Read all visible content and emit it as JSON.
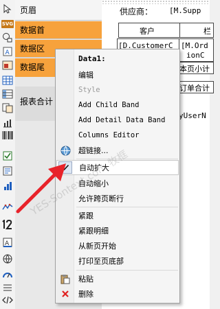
{
  "toolbar": {
    "items": [
      {
        "icon": "arrow-tool-icon"
      },
      {
        "icon": "svg-object-icon",
        "label": "SVG"
      },
      {
        "icon": "shape-icon"
      },
      {
        "icon": "text-object-icon"
      },
      {
        "icon": "picture-icon"
      },
      {
        "icon": "table-icon"
      },
      {
        "icon": "matrix-icon"
      },
      {
        "icon": "subreport-icon"
      },
      {
        "icon": "barcode-icon"
      },
      {
        "icon": "checkbox-icon"
      },
      {
        "icon": "rich-text-icon"
      },
      {
        "icon": "chart-icon"
      },
      {
        "icon": "sparkline-icon"
      },
      {
        "icon": "zip-code-icon"
      },
      {
        "icon": "cellular-text-icon"
      },
      {
        "icon": "map-icon"
      },
      {
        "icon": "gauge-icon"
      },
      {
        "icon": "html-icon"
      }
    ]
  },
  "bands": {
    "page_header": "页眉",
    "data_header": "数据首",
    "data_area": "数据区",
    "data_footer": "数据尾",
    "report_summary": "报表合计"
  },
  "surface": {
    "supplier_label": "供应商：",
    "supplier_value": "[M.Supp",
    "customer_header": "客户",
    "col2_header": "栏",
    "customer_field": "[D.CustomerC",
    "order_field": "[M.Ord",
    "order_field_2": "ionC",
    "page_subtotal": "本页小计",
    "order_total": "订单合计",
    "user_field": "yUserN"
  },
  "menu": {
    "title": "Data1:",
    "items": [
      {
        "label": "编辑",
        "enabled": true
      },
      {
        "label": "Style",
        "enabled": false
      },
      {
        "label": "Add Child Band",
        "enabled": true
      },
      {
        "label": "Add Detail Data Band",
        "enabled": true
      },
      {
        "label": "Columns Editor",
        "enabled": true
      },
      {
        "label": "超链接...",
        "enabled": true,
        "icon": "globe-icon"
      },
      {
        "label": "自动扩大",
        "enabled": true,
        "checked": true
      },
      {
        "label": "自动缩小",
        "enabled": true
      },
      {
        "label": "允许跨页断行",
        "enabled": true
      },
      {
        "label": "紧跟",
        "enabled": true
      },
      {
        "label": "紧跟明细",
        "enabled": true
      },
      {
        "label": "从新页开始",
        "enabled": true
      },
      {
        "label": "打印至页底部",
        "enabled": true
      },
      {
        "label": "粘贴",
        "enabled": true,
        "icon": "paste-icon"
      },
      {
        "label": "删除",
        "enabled": true,
        "icon": "delete-icon"
      }
    ]
  },
  "watermark": "YES-Sontext.com 牧框",
  "colors": {
    "band_selected": "#f7a23c",
    "arrow": "#e8232a",
    "delete_icon": "#e02020"
  }
}
